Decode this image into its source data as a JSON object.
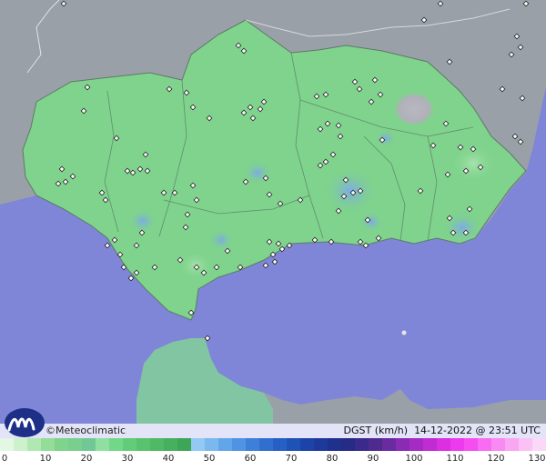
{
  "map": {
    "region": "Andalucía",
    "colors": {
      "sea": "#7f86d8",
      "land_outside": "#9aa0a8",
      "region_fill": "#7fd38c",
      "calm_patch": "#b0b0b8",
      "breezy_patch": "#8fb4e6",
      "station": "#ffffff"
    }
  },
  "footer": {
    "brand": "©Meteoclimatic",
    "variable": "DGST (km/h)",
    "datetime": "14-12-2022 @ 23:51 UTC"
  },
  "legend": {
    "ticks": [
      "0",
      "10",
      "20",
      "30",
      "40",
      "50",
      "60",
      "70",
      "80",
      "90",
      "100",
      "110",
      "120",
      "130"
    ],
    "colors": [
      "#e3f7e3",
      "#cdf0cd",
      "#b0e8b2",
      "#93dd98",
      "#7fd38c",
      "#79cf8e",
      "#72c895",
      "#8fe0a0",
      "#72d888",
      "#62cc79",
      "#58c26f",
      "#4fb966",
      "#46b05e",
      "#3ea657",
      "#93c9f3",
      "#7ab8ee",
      "#62a6e9",
      "#4f93e2",
      "#3d80da",
      "#306fd0",
      "#2660c4",
      "#1f52b6",
      "#1c44a8",
      "#1d3a9a",
      "#20318d",
      "#262b86",
      "#3a2b8a",
      "#4f2b90",
      "#6a2ba0",
      "#8a2bb3",
      "#a42bc4",
      "#c02bd4",
      "#db2fe2",
      "#ee3aee",
      "#f64df0",
      "#f76cf0",
      "#f88af1",
      "#f9a6f3",
      "#fac1f5",
      "#fbd8f7"
    ]
  }
}
